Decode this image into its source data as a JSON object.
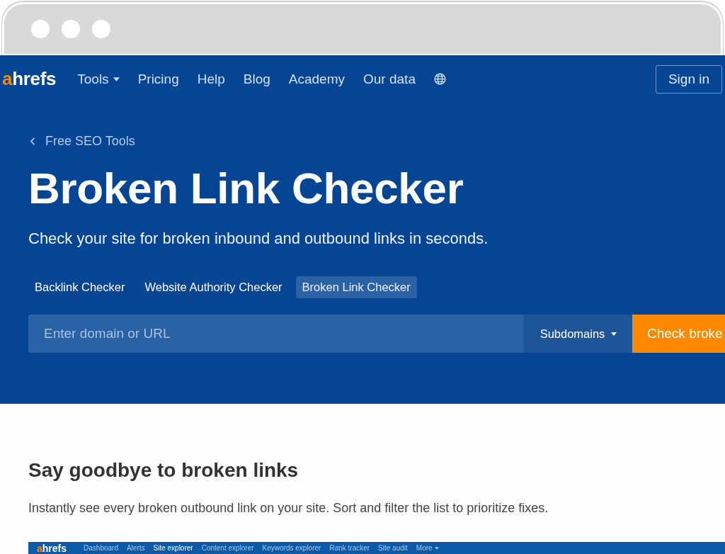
{
  "nav": {
    "logo": {
      "accent": "a",
      "rest": "hrefs"
    },
    "items": [
      {
        "label": "Tools",
        "dropdown": true
      },
      {
        "label": "Pricing",
        "dropdown": false
      },
      {
        "label": "Help",
        "dropdown": false
      },
      {
        "label": "Blog",
        "dropdown": false
      },
      {
        "label": "Academy",
        "dropdown": false
      },
      {
        "label": "Our data",
        "dropdown": false
      }
    ],
    "sign_in": "Sign in"
  },
  "hero": {
    "back_link": "Free SEO Tools",
    "title": "Broken Link Checker",
    "subtitle": "Check your site for broken inbound and outbound links in seconds.",
    "tabs": [
      {
        "label": "Backlink Checker",
        "selected": false
      },
      {
        "label": "Website Authority Checker",
        "selected": false
      },
      {
        "label": "Broken Link Checker",
        "selected": true
      }
    ],
    "search": {
      "placeholder": "Enter domain or URL",
      "scope": "Subdomains",
      "button": "Check broke"
    }
  },
  "section": {
    "heading": "Say goodbye to broken links",
    "text": "Instantly see every broken outbound link on your site. Sort and filter the list to prioritize fixes."
  },
  "app_preview": {
    "logo": {
      "accent": "a",
      "rest": "hrefs"
    },
    "menu": [
      {
        "label": "Dashboard",
        "selected": false,
        "dropdown": false
      },
      {
        "label": "Alerts",
        "selected": false,
        "dropdown": false
      },
      {
        "label": "Site explorer",
        "selected": true,
        "dropdown": false
      },
      {
        "label": "Content explorer",
        "selected": false,
        "dropdown": false
      },
      {
        "label": "Keywords explorer",
        "selected": false,
        "dropdown": false
      },
      {
        "label": "Rank tracker",
        "selected": false,
        "dropdown": false
      },
      {
        "label": "Site audit",
        "selected": false,
        "dropdown": false
      },
      {
        "label": "More",
        "selected": false,
        "dropdown": true
      }
    ]
  }
}
